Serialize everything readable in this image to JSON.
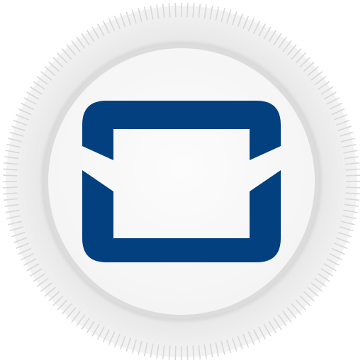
{
  "app": {
    "icon_name": "mail-app-icon",
    "glyph_name": "envelope-icon"
  },
  "colors": {
    "background": "#ffffff",
    "outer_ring": "#e6e6e6",
    "ring_ticks": "#d8d8d8",
    "inner_ring": "#dcdcdc",
    "disc": "#fafafa",
    "glyph": "#034080"
  }
}
